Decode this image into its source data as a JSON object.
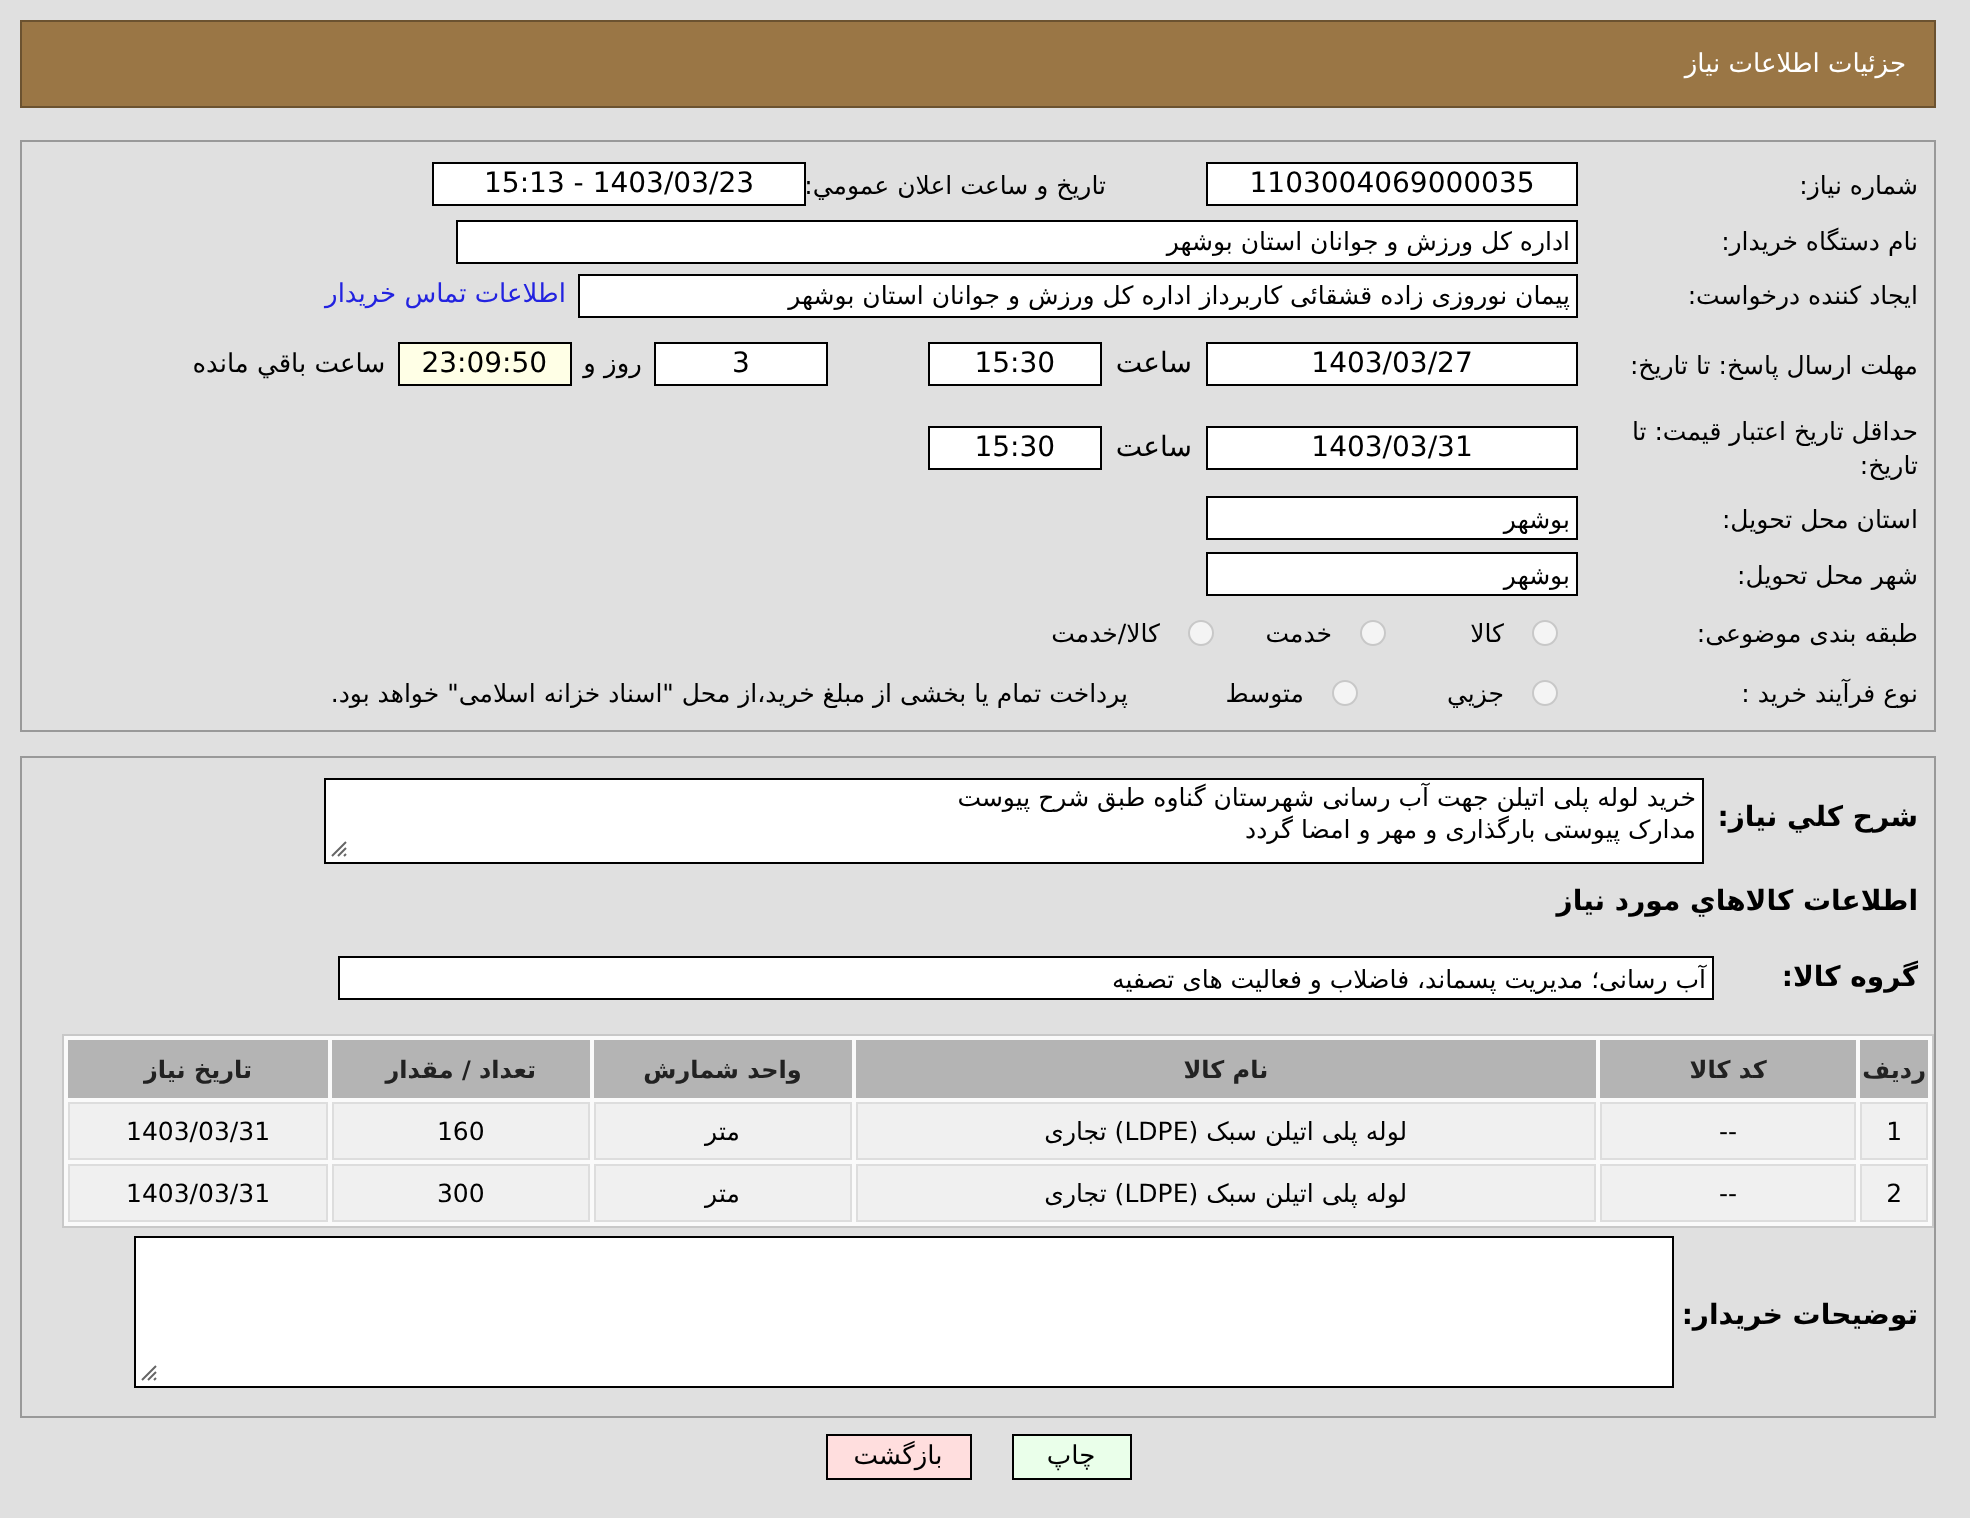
{
  "header": {
    "title": "جزئیات اطلاعات نیاز"
  },
  "need_number": {
    "label": "شماره نیاز:",
    "value": "1103004069000035"
  },
  "announce": {
    "label": "تاریخ و ساعت اعلان عمومي:",
    "value": "1403/03/23 - 15:13"
  },
  "buyer": {
    "label": "نام دستگاه خریدار:",
    "value": "اداره کل ورزش و جوانان استان بوشهر"
  },
  "creator": {
    "label": "ایجاد کننده درخواست:",
    "value": "پیمان نوروزی زاده قشقائی کاربرداز اداره کل ورزش و جوانان استان بوشهر",
    "link": "اطلاعات تماس خریدار"
  },
  "reply_deadline": {
    "label": "مهلت ارسال پاسخ: تا تاریخ:",
    "date": "1403/03/27",
    "time_label": "ساعت",
    "time": "15:30",
    "days": "3",
    "days_label": "روز و",
    "remaining": "23:09:50",
    "remaining_label": "ساعت باقي مانده"
  },
  "price_validity": {
    "label": "حداقل تاریخ اعتبار قیمت: تا تاریخ:",
    "date": "1403/03/31",
    "time_label": "ساعت",
    "time": "15:30"
  },
  "province": {
    "label": "استان محل تحویل:",
    "value": "بوشهر"
  },
  "city": {
    "label": "شهر محل تحویل:",
    "value": "بوشهر"
  },
  "category": {
    "label": "طبقه بندی موضوعی:",
    "options": [
      {
        "label": "کالا",
        "selected": false
      },
      {
        "label": "خدمت",
        "selected": false
      },
      {
        "label": "کالا/خدمت",
        "selected": false
      }
    ]
  },
  "process": {
    "label": "نوع فرآیند خرید :",
    "options": [
      {
        "label": "جزيي",
        "selected": false
      },
      {
        "label": "متوسط",
        "selected": false
      }
    ],
    "note": "پرداخت تمام یا بخشی از مبلغ خرید،از محل \"اسناد خزانه اسلامی\" خواهد بود."
  },
  "description": {
    "label": "شرح كلي نياز:",
    "lines": [
      "خرید لوله پلی اتیلن جهت آب رسانی شهرستان گناوه طبق شرح پیوست",
      "مدارک پیوستی بارگذاری و مهر و امضا گردد"
    ]
  },
  "goods_title": "اطلاعات كالاهاي مورد نياز",
  "goods_group": {
    "label": "گروه کالا:",
    "value": "آب رسانی؛ مدیریت پسماند، فاضلاب و فعالیت های تصفیه"
  },
  "table": {
    "columns": [
      "رديف",
      "کد کالا",
      "نام کالا",
      "واحد شمارش",
      "تعداد / مقدار",
      "تاریخ نیاز"
    ],
    "rows": [
      [
        "1",
        "--",
        "لوله پلی اتیلن سبک (LDPE) تجاری",
        "متر",
        "160",
        "1403/03/31"
      ],
      [
        "2",
        "--",
        "لوله پلی اتیلن سبک (LDPE) تجاری",
        "متر",
        "300",
        "1403/03/31"
      ]
    ]
  },
  "buyer_notes": {
    "label": "توضیحات خریدار:"
  },
  "buttons": [
    {
      "label": "چاپ",
      "kind": "print"
    },
    {
      "label": "بازگشت",
      "kind": "back"
    }
  ]
}
